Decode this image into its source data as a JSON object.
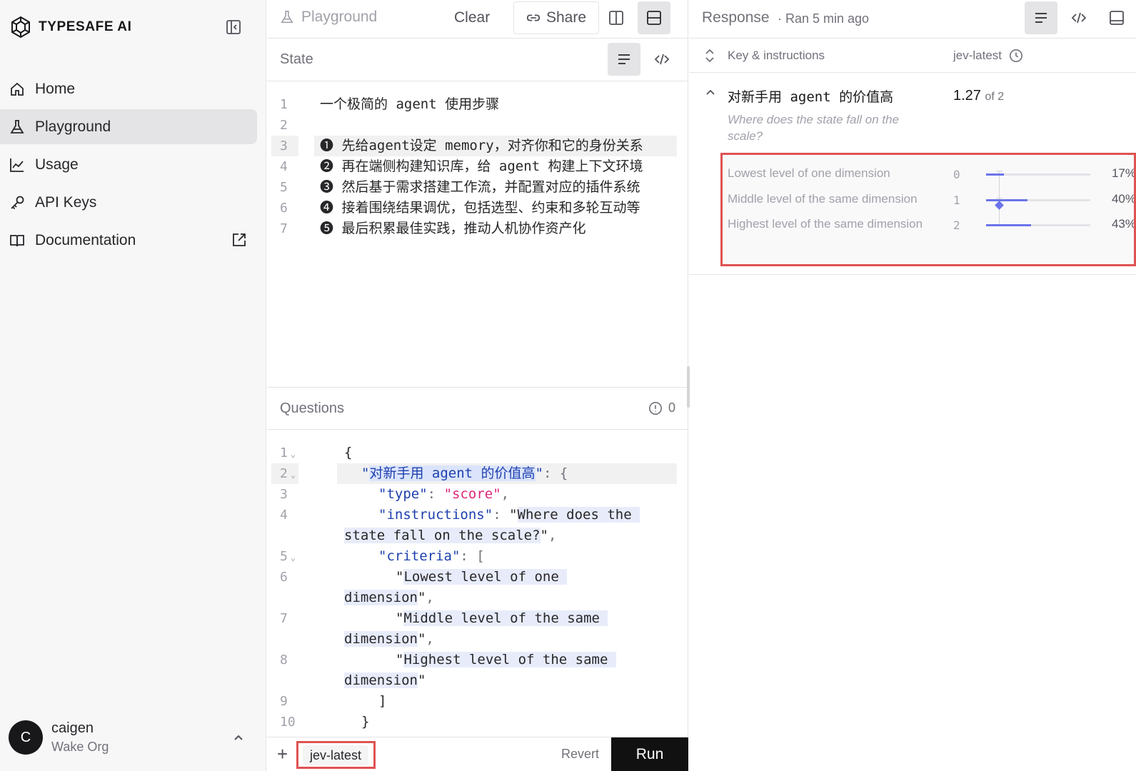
{
  "sidebar": {
    "brand": "TYPESAFE AI",
    "nav": [
      {
        "label": "Home",
        "icon": "home-icon"
      },
      {
        "label": "Playground",
        "icon": "flask-icon",
        "active": true
      },
      {
        "label": "Usage",
        "icon": "chart-line-icon"
      },
      {
        "label": "API Keys",
        "icon": "key-icon"
      },
      {
        "label": "Documentation",
        "icon": "book-icon",
        "external": true
      }
    ],
    "user": {
      "initial": "C",
      "name": "caigen",
      "org": "Wake Org"
    }
  },
  "middle": {
    "toolbar": {
      "title": "Playground",
      "clear": "Clear",
      "share": "Share"
    },
    "state": {
      "title": "State",
      "lines": [
        {
          "n": "1",
          "text": "一个极简的 agent 使用步骤"
        },
        {
          "n": "2",
          "text": ""
        },
        {
          "n": "3",
          "text": "❶ 先给agent设定 memory，对齐你和它的身份关系"
        },
        {
          "n": "4",
          "text": "❷ 再在端侧构建知识库，给 agent 构建上下文环境"
        },
        {
          "n": "5",
          "text": "❸ 然后基于需求搭建工作流，并配置对应的插件系统"
        },
        {
          "n": "6",
          "text": "❹ 接着围绕结果调优，包括选型、约束和多轮互动等"
        },
        {
          "n": "7",
          "text": "❺ 最后积累最佳实践，推动人机协作资产化"
        }
      ]
    },
    "questions": {
      "title": "Questions",
      "count": "0",
      "ln": [
        "1",
        "2",
        "3",
        "4",
        "5",
        "6",
        "7",
        "8",
        "9",
        "10"
      ],
      "open_brace": "{",
      "key": "对新手用 agent 的价值高",
      "type_key": "type",
      "type_val": "score",
      "inst_key": "instructions",
      "inst_val_1": "Where does the",
      "inst_val_2": "state fall on the scale?",
      "crit_key": "criteria",
      "c1a": "Lowest level of one",
      "c1b": "dimension",
      "c2a": "Middle level of the same",
      "c2b": "dimension",
      "c3a": "Highest level of the same",
      "c3b": "dimension",
      "close_bracket": "]",
      "close_brace": "}"
    },
    "footer": {
      "plus": "+",
      "tag": "jev-latest",
      "revert": "Revert",
      "run": "Run"
    }
  },
  "right": {
    "title": "Response",
    "meta": "· Ran 5 min ago",
    "col_key": "Key & instructions",
    "col_model": "jev-latest",
    "item": {
      "key": "对新手用 agent 的价值高",
      "instructions": "Where does the state fall on the scale?",
      "score": "1.27",
      "score_of": "of 2",
      "score_value": 1.27,
      "criteria": [
        {
          "label": "Lowest level of one dimension",
          "index": "0",
          "pct": "17%",
          "share": 0.17
        },
        {
          "label": "Middle level of the same dimension",
          "index": "1",
          "pct": "40%",
          "share": 0.4
        },
        {
          "label": "Highest level of the same dimension",
          "index": "2",
          "pct": "43%",
          "share": 0.43
        }
      ]
    }
  },
  "colors": {
    "accent": "#6b74e8",
    "highlight": "#e05252",
    "run_button": "#111111"
  }
}
